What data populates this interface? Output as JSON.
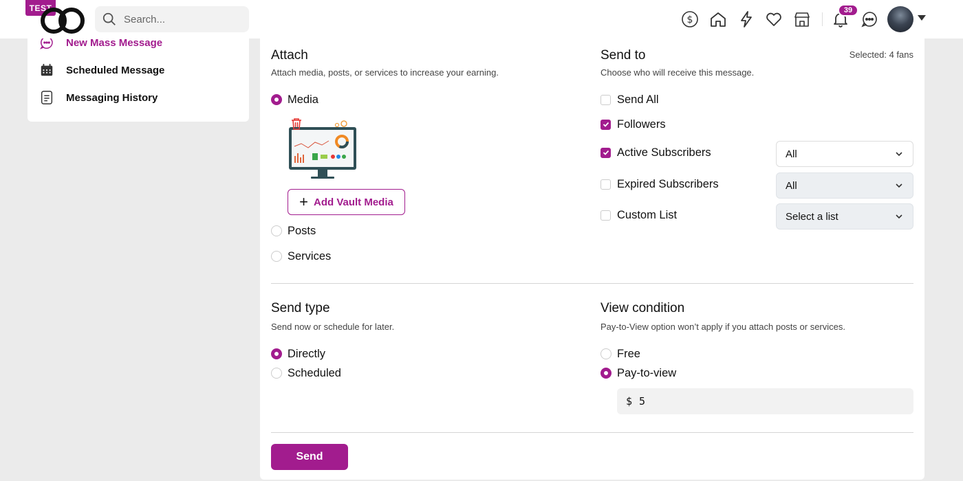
{
  "header": {
    "test_badge": "TEST",
    "search_placeholder": "Search...",
    "notification_count": "39",
    "icons": [
      "dollar-icon",
      "home-icon",
      "lightning-icon",
      "heart-icon",
      "store-icon",
      "bell-icon",
      "chat-icon"
    ]
  },
  "sidebar": {
    "items": [
      {
        "label": "New Mass Message",
        "icon": "chat-dots-icon",
        "active": true
      },
      {
        "label": "Scheduled Message",
        "icon": "calendar-icon",
        "active": false
      },
      {
        "label": "Messaging History",
        "icon": "document-icon",
        "active": false
      }
    ]
  },
  "attach": {
    "title": "Attach",
    "subtitle": "Attach media, posts, or services to increase your earning.",
    "options": [
      {
        "label": "Media",
        "selected": true
      },
      {
        "label": "Posts",
        "selected": false
      },
      {
        "label": "Services",
        "selected": false
      }
    ],
    "add_vault_label": "Add Vault Media"
  },
  "send_to": {
    "title": "Send to",
    "subtitle": "Choose who will receive this message.",
    "selected_count": "Selected: 4 fans",
    "options": [
      {
        "label": "Send All",
        "checked": false
      },
      {
        "label": "Followers",
        "checked": true
      },
      {
        "label": "Active Subscribers",
        "checked": true,
        "select": "All"
      },
      {
        "label": "Expired Subscribers",
        "checked": false,
        "select": "All"
      },
      {
        "label": "Custom List",
        "checked": false,
        "select": "Select a list"
      }
    ]
  },
  "send_type": {
    "title": "Send type",
    "subtitle": "Send now or schedule for later.",
    "options": [
      {
        "label": "Directly",
        "selected": true
      },
      {
        "label": "Scheduled",
        "selected": false
      }
    ]
  },
  "view_condition": {
    "title": "View condition",
    "subtitle": "Pay-to-View option won’t apply if you attach posts or services.",
    "options": [
      {
        "label": "Free",
        "selected": false
      },
      {
        "label": "Pay-to-view",
        "selected": true
      }
    ],
    "currency": "$",
    "price": "5"
  },
  "send_button": "Send",
  "colors": {
    "accent": "#a21c8e",
    "background": "#ebebeb"
  }
}
